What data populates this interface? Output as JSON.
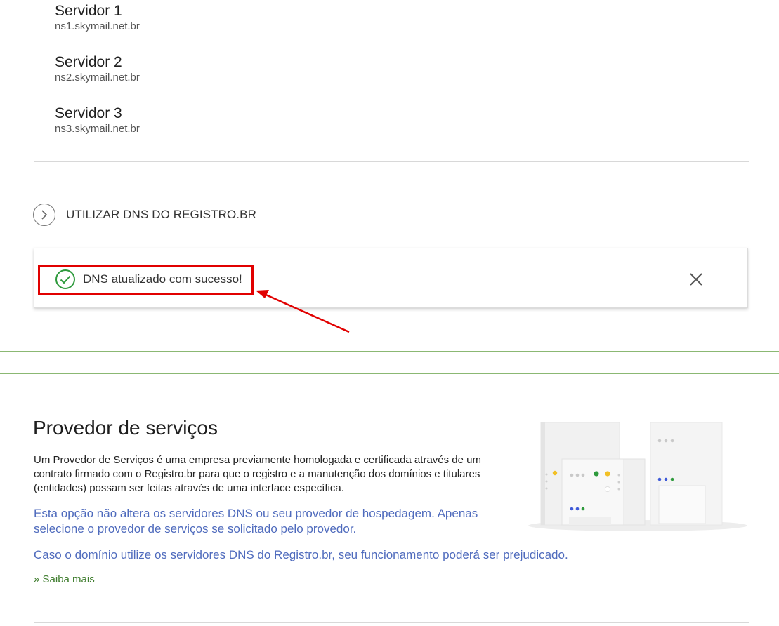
{
  "servers": [
    {
      "name": "Servidor 1",
      "host": "ns1.skymail.net.br"
    },
    {
      "name": "Servidor 2",
      "host": "ns2.skymail.net.br"
    },
    {
      "name": "Servidor 3",
      "host": "ns3.skymail.net.br"
    }
  ],
  "dns_toggle": {
    "label": "UTILIZAR DNS DO REGISTRO.BR",
    "icon": "chevron-right-icon"
  },
  "toast": {
    "message": "DNS atualizado com sucesso!",
    "status_icon": "check-circle-icon",
    "close_icon": "close-icon",
    "status_color": "#2e9a3c",
    "highlight_color": "#e10000"
  },
  "provider": {
    "title": "Provedor de serviços",
    "description": "Um Provedor de Serviços é uma empresa previamente homologada e certificada através de um contrato firmado com o Registro.br para que o registro e a manutenção dos domínios e titulares (entidades) possam ser feitas através de uma interface específica.",
    "note1": "Esta opção não altera os servidores DNS ou seu provedor de hospedagem. Apenas selecione o provedor de serviços se solicitado pelo provedor.",
    "note2": "Caso o domínio utilize os servidores DNS do Registro.br, seu funcionamento poderá ser prejudicado.",
    "link": "» Saiba mais",
    "illustration_icon": "servers-illustration-icon"
  },
  "colors": {
    "divider_green": "#8bb873",
    "link_blue": "#4f6bbd",
    "link_green": "#3f7d2e"
  }
}
